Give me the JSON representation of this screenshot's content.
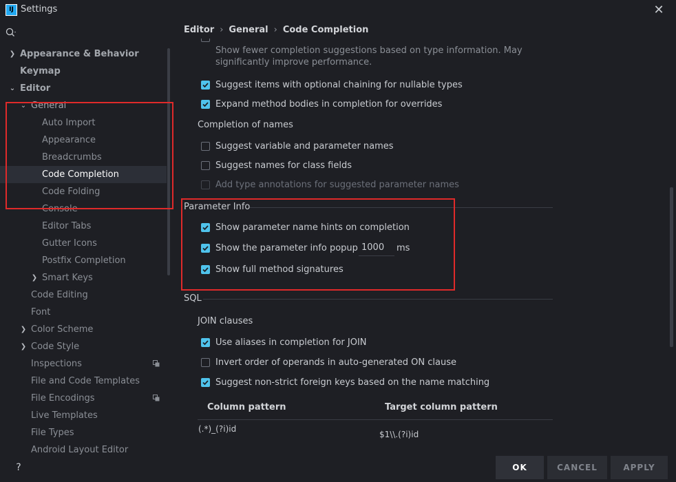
{
  "window": {
    "title": "Settings",
    "logo_text": "IJ"
  },
  "sidebar": {
    "items": [
      {
        "label": "Appearance & Behavior",
        "chevron": ">"
      },
      {
        "label": "Keymap"
      },
      {
        "label": "Editor",
        "chevron": "v"
      },
      {
        "label": "General",
        "chevron": "v"
      },
      {
        "label": "Auto Import"
      },
      {
        "label": "Appearance"
      },
      {
        "label": "Breadcrumbs"
      },
      {
        "label": "Code Completion"
      },
      {
        "label": "Code Folding"
      },
      {
        "label": "Console"
      },
      {
        "label": "Editor Tabs"
      },
      {
        "label": "Gutter Icons"
      },
      {
        "label": "Postfix Completion"
      },
      {
        "label": "Smart Keys",
        "chevron": ">"
      },
      {
        "label": "Code Editing"
      },
      {
        "label": "Font"
      },
      {
        "label": "Color Scheme",
        "chevron": ">"
      },
      {
        "label": "Code Style",
        "chevron": ">"
      },
      {
        "label": "Inspections"
      },
      {
        "label": "File and Code Templates"
      },
      {
        "label": "File Encodings"
      },
      {
        "label": "Live Templates"
      },
      {
        "label": "File Types"
      },
      {
        "label": "Android Layout Editor"
      }
    ]
  },
  "breadcrumb": {
    "items": [
      "Editor",
      "General",
      "Code Completion"
    ],
    "separator": "›"
  },
  "content": {
    "hint_lines": [
      "Show fewer completion suggestions based on type information. May",
      "significantly improve performance."
    ],
    "top_checks": [
      {
        "label": "Suggest items with optional chaining for nullable types",
        "checked": true
      },
      {
        "label": "Expand method bodies in completion for overrides",
        "checked": true
      }
    ],
    "names_title": "Completion of names",
    "names_checks": [
      {
        "label": "Suggest variable and parameter names",
        "checked": false
      },
      {
        "label": "Suggest names for class fields",
        "checked": false
      },
      {
        "label": "Add type annotations for suggested parameter names",
        "checked": false,
        "disabled": true
      }
    ],
    "param_title": "Parameter Info",
    "param_checks": [
      {
        "label": "Show parameter name hints on completion",
        "checked": true
      },
      {
        "label": "Show the parameter info popup in",
        "checked": true
      },
      {
        "label": "Show full method signatures",
        "checked": true
      }
    ],
    "popup_delay": "1000",
    "popup_unit": "ms",
    "sql_title": "SQL",
    "join_title": "JOIN clauses",
    "sql_checks": [
      {
        "label": "Use aliases in completion for JOIN",
        "checked": true
      },
      {
        "label": "Invert order of operands in auto-generated ON clause",
        "checked": false
      },
      {
        "label": "Suggest non-strict foreign keys based on the name matching",
        "checked": true
      }
    ],
    "table": {
      "headers": [
        "Column pattern",
        "Target column pattern"
      ],
      "rows": [
        [
          "(.*)_(?i)id",
          "$1\\\\.(?i)id"
        ]
      ]
    }
  },
  "buttons": {
    "help": "?",
    "ok": "OK",
    "cancel": "CANCEL",
    "apply": "APPLY"
  },
  "colors": {
    "accent": "#4fc3ec",
    "highlight": "#e02a2a",
    "selection": "#2c2f37"
  }
}
